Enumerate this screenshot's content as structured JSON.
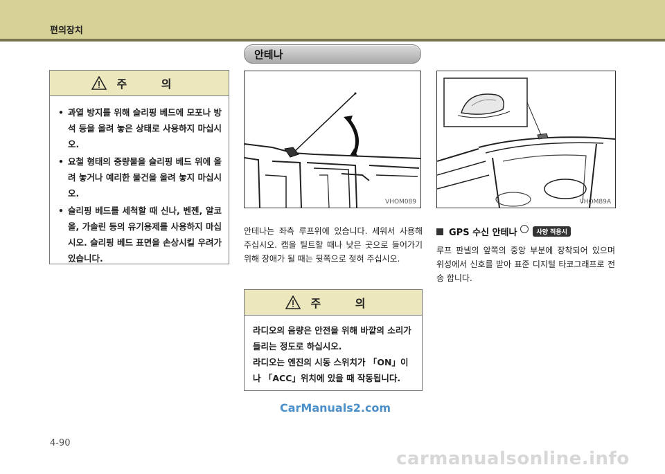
{
  "header": {
    "title": "편의장치"
  },
  "section": {
    "title": "안테나"
  },
  "caution1": {
    "heading": "주 의",
    "items": [
      "과열 방지를 위해 슬리핑 베드에 모포나 방석 등을 올려 놓은 상태로 사용하지 마십시오.",
      "요철 형태의 중량물을 슬리핑 베드 위에 올려 놓거나 예리한 물건을 올려 놓지 마십시오.",
      "슬리핑 베드를 세척할 때 신나, 벤젠, 알코올, 가솔린 등의 유기용제를 사용하지 마십시오. 슬리핑 베드 표면을 손상시킬 우려가 있습니다."
    ]
  },
  "figure1": {
    "code": "VHOM089"
  },
  "figure2": {
    "code": "VHOM89A"
  },
  "antenna_text": "안테나는 좌측 루프위에 있습니다. 세워서 사용해 주십시오. 캡을 틸트할 때나 낮은 곳으로 들어가기 위해 장애가 될 때는 뒷쪽으로 젖혀 주십시오.",
  "caution2": {
    "heading": "주 의",
    "lines": [
      "라디오의 음량은 안전을 위해 바깥의 소리가 들리는 정도로 하십시오.",
      "라디오는 엔진의 시동 스위치가 「ON」이나 「ACC」위치에 있을 때 작동됩니다."
    ]
  },
  "gps": {
    "title": "GPS 수신 안테나",
    "badge": "사양 적용시",
    "text": "루프 판넬의 앞쪽의 중앙 부분에 장착되어 있으며 위성에서 신호를 받아 표준 디지털 타코그래프로 전송 합니다."
  },
  "watermark": "CarManuals2.com",
  "page_number": "4-90",
  "bottom_watermark": "carmanualsonline.info"
}
